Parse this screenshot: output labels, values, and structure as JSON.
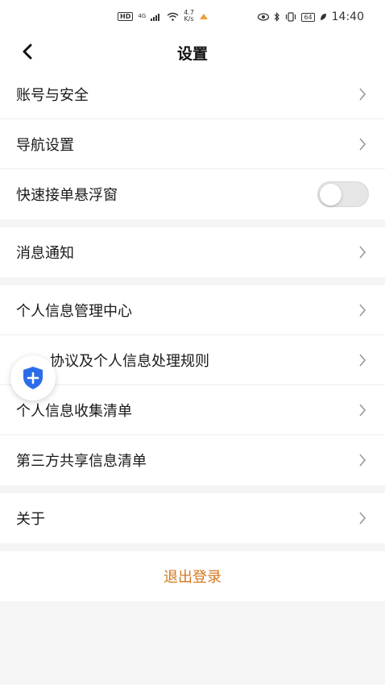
{
  "status_bar": {
    "time": "14:40",
    "network": "4G",
    "speed_value": "4.7",
    "speed_unit": "K/s",
    "battery": "64",
    "hd_badge": "HD"
  },
  "header": {
    "title": "设置"
  },
  "groups": [
    {
      "items": [
        {
          "label": "账号与安全",
          "type": "link"
        },
        {
          "label": "导航设置",
          "type": "link"
        },
        {
          "label": "快速接单悬浮窗",
          "type": "toggle",
          "enabled": false
        }
      ]
    },
    {
      "items": [
        {
          "label": "消息通知",
          "type": "link"
        }
      ]
    },
    {
      "items": [
        {
          "label": "个人信息管理中心",
          "type": "link"
        },
        {
          "label": "协议及个人信息处理规则",
          "type": "link"
        },
        {
          "label": "个人信息收集清单",
          "type": "link"
        },
        {
          "label": "第三方共享信息清单",
          "type": "link"
        }
      ]
    },
    {
      "items": [
        {
          "label": "关于",
          "type": "link"
        }
      ]
    }
  ],
  "logout": {
    "label": "退出登录"
  },
  "colors": {
    "accent": "#d2781e",
    "shield": "#2b6de8"
  },
  "icons": {
    "back": "chevron-left-icon",
    "row_arrow": "chevron-right-icon",
    "floating": "shield-plus-icon"
  }
}
